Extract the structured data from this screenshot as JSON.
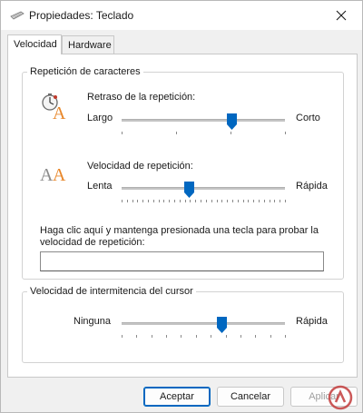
{
  "window": {
    "title": "Propiedades: Teclado",
    "close_glyph": "✕"
  },
  "tabs": [
    {
      "label": "Velocidad",
      "active": true
    },
    {
      "label": "Hardware",
      "active": false
    }
  ],
  "repeat_group": {
    "label": "Repetición de caracteres",
    "delay": {
      "label": "Retraso de la repetición:",
      "min_label": "Largo",
      "max_label": "Corto",
      "value": 0.67,
      "tick_count": 4
    },
    "rate": {
      "label": "Velocidad de repetición:",
      "min_label": "Lenta",
      "max_label": "Rápida",
      "value": 0.41,
      "tick_count": 32
    },
    "test_prompt_line1": "Haga clic aquí y mantenga presionada una tecla para probar la",
    "test_prompt_line2": "velocidad de repetición:",
    "test_value": ""
  },
  "cursor_group": {
    "label": "Velocidad de intermitencia del cursor",
    "min_label": "Ninguna",
    "max_label": "Rápida",
    "value": 0.61,
    "tick_count": 12
  },
  "buttons": {
    "accept": "Aceptar",
    "cancel": "Cancelar",
    "apply": "Aplicar"
  },
  "colors": {
    "accent": "#0067c0",
    "icon_orange": "#e8872a",
    "icon_gray": "#8c8c8c"
  }
}
